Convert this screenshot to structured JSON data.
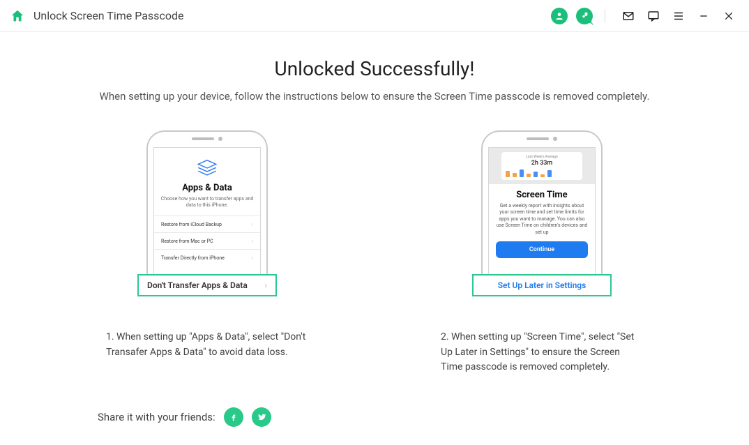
{
  "titlebar": {
    "title": "Unlock Screen Time Passcode"
  },
  "heading": "Unlocked Successfully!",
  "subheading": "When setting up your device, follow the instructions below to ensure the Screen Time passcode is removed completely.",
  "left": {
    "screen_title": "Apps & Data",
    "screen_sub": "Choose how you want to transfer apps and data to this iPhone.",
    "options": [
      "Restore from iCloud Backup",
      "Restore from Mac or PC",
      "Transfer Directly from iPhone"
    ],
    "highlight_label": "Don't Transfer Apps & Data",
    "caption": "1. When setting up \"Apps & Data\", select \"Don't Transafer Apps & Data\" to avoid data loss."
  },
  "right": {
    "avg_label": "Last Week's Average",
    "avg_value": "2h 33m",
    "screen_title": "Screen Time",
    "screen_body": "Get a weekly report with insights about your screen time and set time limits for apps you want to manage. You can also use Screen Time on children's devices and set up",
    "continue_label": "Continue",
    "highlight_label": "Set Up Later in Settings",
    "caption": "2. When setting up \"Screen Time\", select \"Set Up Later in Settings\" to ensure the Screen Time passcode is removed completely."
  },
  "share": {
    "label": "Share it with your friends:"
  }
}
